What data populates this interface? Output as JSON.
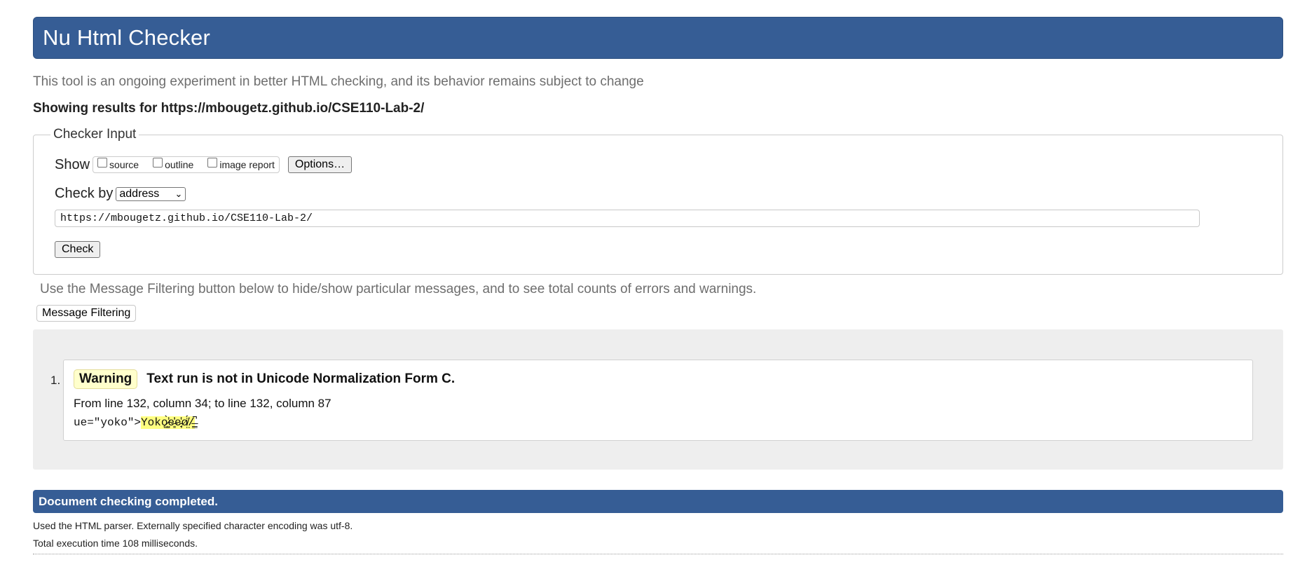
{
  "header": {
    "title": "Nu Html Checker"
  },
  "subtitle": "This tool is an ongoing experiment in better HTML checking, and its behavior remains subject to change",
  "showing": {
    "prefix": "Showing results for ",
    "url": "https://mbougetz.github.io/CSE110-Lab-2/"
  },
  "checker_input": {
    "legend": "Checker Input",
    "show_label": "Show",
    "show_options": [
      {
        "label": "source",
        "checked": false
      },
      {
        "label": "outline",
        "checked": false
      },
      {
        "label": "image report",
        "checked": false
      }
    ],
    "options_button": "Options…",
    "check_by_label": "Check by",
    "check_by_value": "address",
    "url_value": "https://mbougetz.github.io/CSE110-Lab-2/",
    "check_button": "Check"
  },
  "filter": {
    "note": "Use the Message Filtering button below to hide/show particular messages, and to see total counts of errors and warnings.",
    "button": "Message Filtering"
  },
  "messages": [
    {
      "number": "1.",
      "type": "Warning",
      "title": "Text run is not in Unicode Normalization Form C.",
      "location": "From line 132, column 34; to line 132, column 87",
      "extract_prefix": "ue=\"yoko\">",
      "extract_highlight": "Yokǫ̷̛̺͎̀e̶͈̍̓e̵̦̘̔ø̸̤̈́/",
      "extract_suffix": "̶͇̚"
    }
  ],
  "summary": {
    "done": "Document checking completed.",
    "parser": "Used the HTML parser. Externally specified character encoding was utf-8.",
    "time": "Total execution time 108 milliseconds."
  }
}
